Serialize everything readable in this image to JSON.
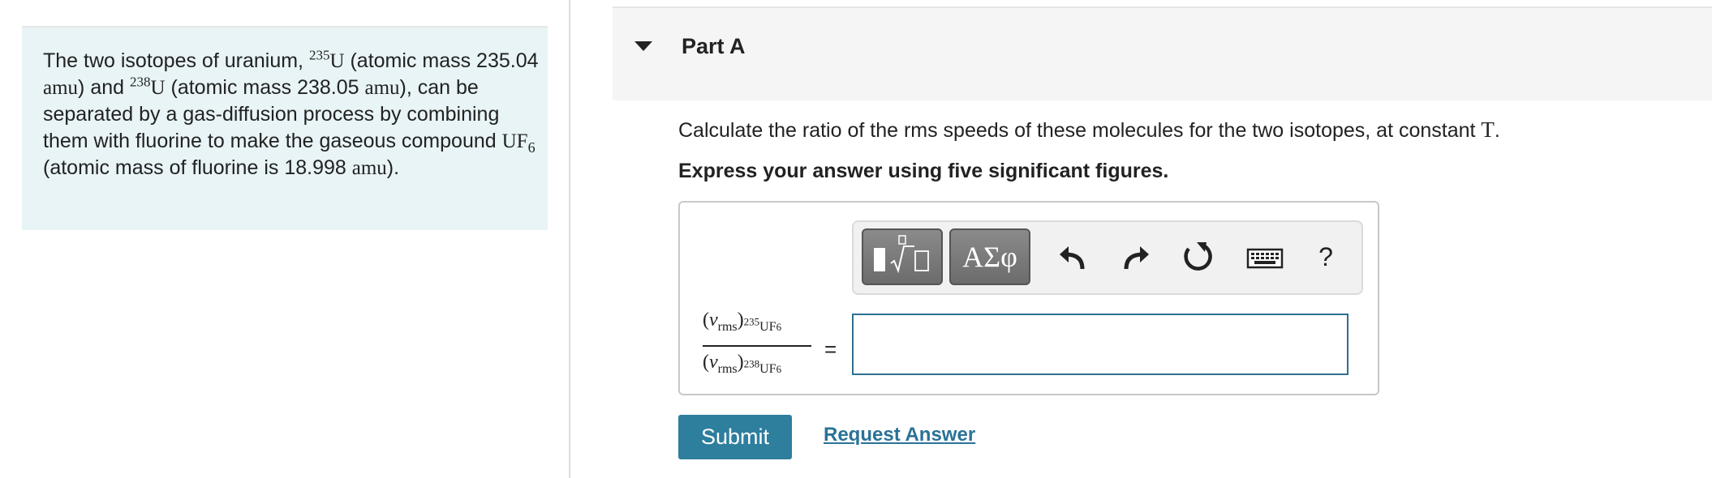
{
  "problem": {
    "t1": "The two isotopes of uranium, ",
    "iso1_mass": "235",
    "sym_U": "U",
    "t2": " (atomic mass 235.04 ",
    "amu": "amu",
    "t3": ") and ",
    "iso2_mass": "238",
    "t4": " (atomic mass 238.05 ",
    "t5": "), can be separated by a gas-diffusion process by combining them with fluorine to make the gaseous compound ",
    "compound": "UF",
    "compound_sub": "6",
    "t6": " (atomic mass of fluorine is 18.998 ",
    "t7": ")."
  },
  "part": {
    "title": "Part A",
    "question_text": "Calculate the ratio of the rms speeds of these molecules for the two isotopes, at constant ",
    "question_var": "T",
    "question_end": ".",
    "instruction": "Express your answer using five significant figures."
  },
  "toolbar": {
    "greek_label": "ΑΣφ",
    "help_label": "?",
    "icons": [
      "math-template-icon",
      "greek-symbols-icon",
      "undo-icon",
      "redo-icon",
      "reset-icon",
      "keyboard-icon",
      "help-icon"
    ]
  },
  "fraction": {
    "open": "(",
    "v": "v",
    "rms": "rms",
    "close": ")",
    "num_mass": "235",
    "den_mass": "238",
    "uf": "UF",
    "six": "6",
    "equals": "="
  },
  "answer": {
    "value": "",
    "placeholder": ""
  },
  "actions": {
    "submit": "Submit",
    "request": "Request Answer"
  },
  "colors": {
    "problem_bg": "#e8f4f6",
    "header_bg": "#f5f5f5",
    "submit_bg": "#2e7e9e",
    "link": "#2a7296",
    "input_border": "#2f6f8f"
  }
}
